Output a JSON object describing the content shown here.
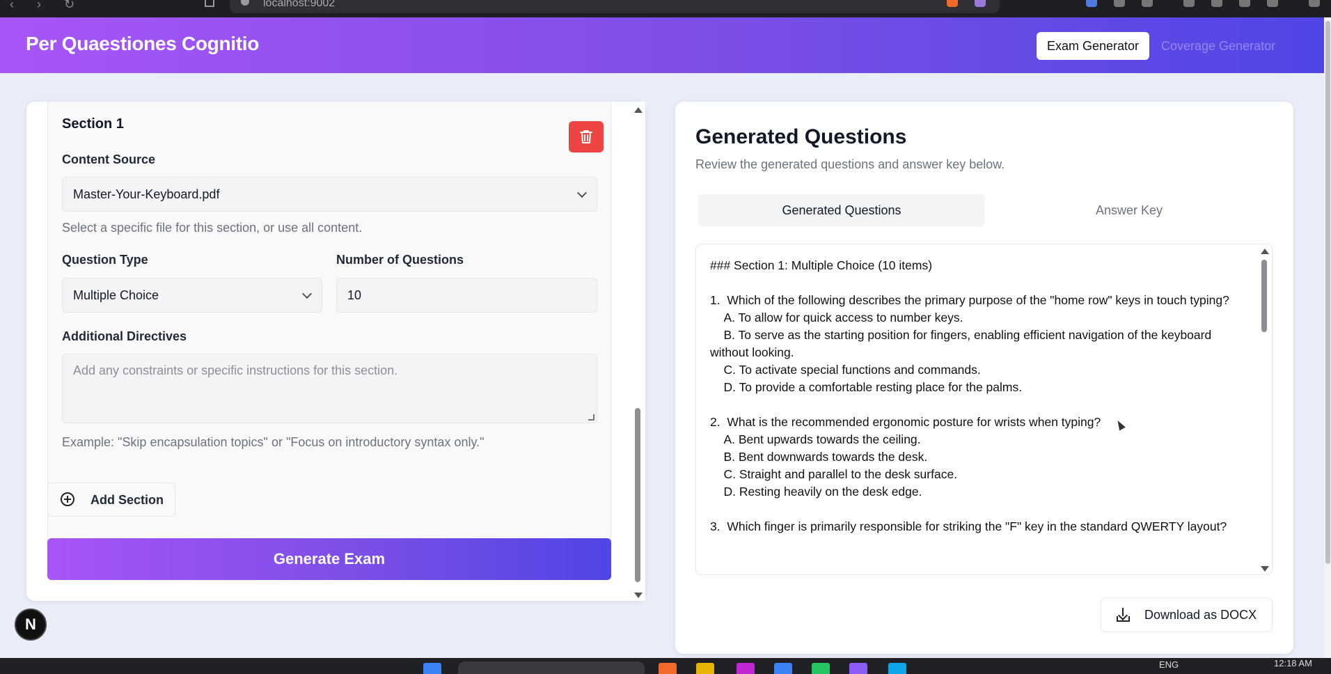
{
  "browser": {
    "url": "localhost:9002"
  },
  "header": {
    "title": "Per Quaestiones Cognitio",
    "nav": [
      {
        "label": "Exam Generator",
        "active": true
      },
      {
        "label": "Coverage Generator",
        "active": false
      }
    ]
  },
  "left_panel": {
    "section": {
      "title": "Section 1",
      "content_source_label": "Content Source",
      "content_source_value": "Master-Your-Keyboard.pdf",
      "content_source_hint": "Select a specific file for this section, or use all content.",
      "question_type_label": "Question Type",
      "question_type_value": "Multiple Choice",
      "num_questions_label": "Number of Questions",
      "num_questions_value": "10",
      "directives_label": "Additional Directives",
      "directives_placeholder": "Add any constraints or specific instructions for this section.",
      "directives_hint": "Example: \"Skip encapsulation topics\" or \"Focus on introductory syntax only.\""
    },
    "add_section_label": "Add Section",
    "generate_label": "Generate Exam"
  },
  "right_panel": {
    "title": "Generated Questions",
    "subtitle": "Review the generated questions and answer key below.",
    "tabs": [
      {
        "label": "Generated Questions",
        "active": true
      },
      {
        "label": "Answer Key",
        "active": false
      }
    ],
    "questions_text": "### Section 1: Multiple Choice (10 items)\n\n1.  Which of the following describes the primary purpose of the \"home row\" keys in touch typing?\n    A. To allow for quick access to number keys.\n    B. To serve as the starting position for fingers, enabling efficient navigation of the keyboard without looking.\n    C. To activate special functions and commands.\n    D. To provide a comfortable resting place for the palms.\n\n2.  What is the recommended ergonomic posture for wrists when typing?\n    A. Bent upwards towards the ceiling.\n    B. Bent downwards towards the desk.\n    C. Straight and parallel to the desk surface.\n    D. Resting heavily on the desk edge.\n\n3.  Which finger is primarily responsible for striking the \"F\" key in the standard QWERTY layout?",
    "download_label": "Download as DOCX"
  },
  "badge": {
    "label": "N"
  },
  "taskbar": {
    "lang": "ENG",
    "time": "12:18 AM"
  },
  "colors": {
    "accent_start": "#a855f7",
    "accent_end": "#4f46e5",
    "danger": "#ef4444"
  }
}
